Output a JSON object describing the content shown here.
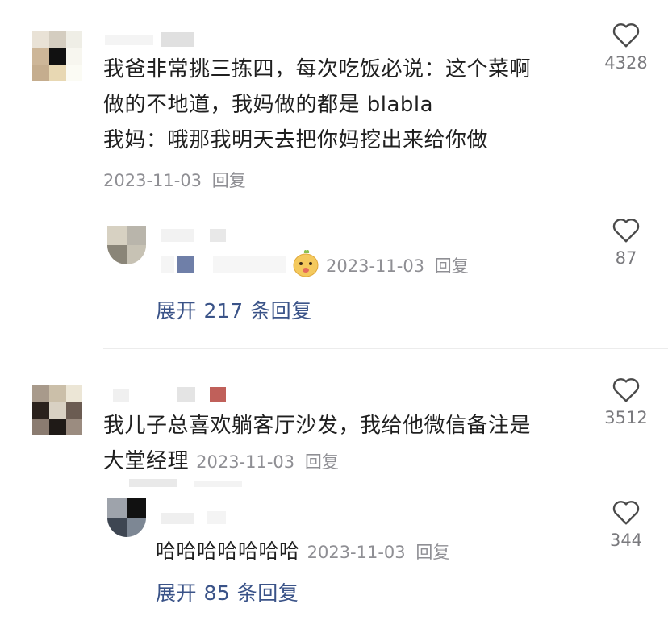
{
  "comments": [
    {
      "text_lines": [
        "我爸非常挑三拣四，每次吃饭必说：这个菜啊",
        "做的不地道，我妈做的都是 blabla",
        "我妈：哦那我明天去把你妈挖出来给你做"
      ],
      "date": "2023-11-03",
      "reply_label": "回复",
      "likes": "4328",
      "reply": {
        "date": "2023-11-03",
        "reply_label": "回复",
        "likes": "87",
        "emoji": "mascot-emoji"
      },
      "expand": "展开 217 条回复"
    },
    {
      "text_lines": [
        "我儿子总喜欢躺客厅沙发，我给他微信备注是",
        "大堂经理"
      ],
      "date": "2023-11-03",
      "reply_label": "回复",
      "likes": "3512",
      "reply": {
        "text": "哈哈哈哈哈哈哈",
        "date": "2023-11-03",
        "reply_label": "回复",
        "likes": "344"
      },
      "expand": "展开 85 条回复"
    }
  ],
  "icons": {
    "like": "heart-outline-icon"
  },
  "colors": {
    "text": "#1f1f1f",
    "meta": "#8f8f94",
    "link": "#3a5388"
  }
}
